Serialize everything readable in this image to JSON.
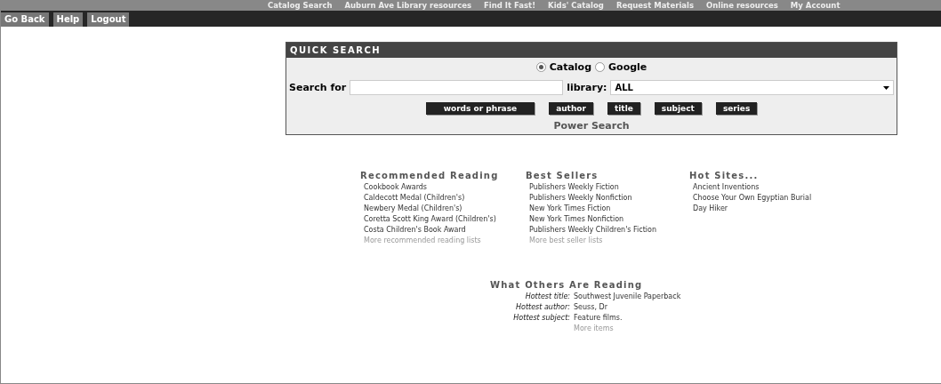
{
  "top_nav": [
    "Catalog Search",
    "Auburn Ave Library resources",
    "Find It Fast!",
    "Kids' Catalog",
    "Request Materials",
    "Online resources",
    "My Account"
  ],
  "tabs": [
    "Go Back",
    "Help",
    "Logout"
  ],
  "quick_search": {
    "title": "QUICK SEARCH",
    "sources": [
      {
        "label": "Catalog",
        "selected": true
      },
      {
        "label": "Google",
        "selected": false
      }
    ],
    "search_label": "Search for",
    "library_label": "library:",
    "library_value": "ALL",
    "buttons": [
      "words or phrase",
      "author",
      "title",
      "subject",
      "series"
    ],
    "power_search": "Power Search"
  },
  "lists": [
    {
      "title": "Recommended Reading",
      "items": [
        "Cookbook Awards",
        "Caldecott Medal (Children's)",
        "Newbery Medal (Children's)",
        "Coretta Scott King Award (Children's)",
        "Costa Children's Book Award"
      ],
      "more": "More recommended reading lists"
    },
    {
      "title": "Best Sellers",
      "items": [
        "Publishers Weekly Fiction",
        "Publishers Weekly Nonfiction",
        "New York Times Fiction",
        "New York Times Nonfiction",
        "Publishers Weekly Children's Fiction"
      ],
      "more": "More best seller lists"
    },
    {
      "title": "Hot Sites...",
      "items": [
        "Ancient Inventions",
        "Choose Your Own Egyptian Burial",
        "Day Hiker"
      ]
    }
  ],
  "others": {
    "title": "What Others Are Reading",
    "rows": [
      {
        "label": "Hottest title:",
        "value": "Southwest Juvenile Paperback"
      },
      {
        "label": "Hottest author:",
        "value": "Seuss, Dr"
      },
      {
        "label": "Hottest subject:",
        "value": "Feature films."
      }
    ],
    "more": "More items"
  }
}
